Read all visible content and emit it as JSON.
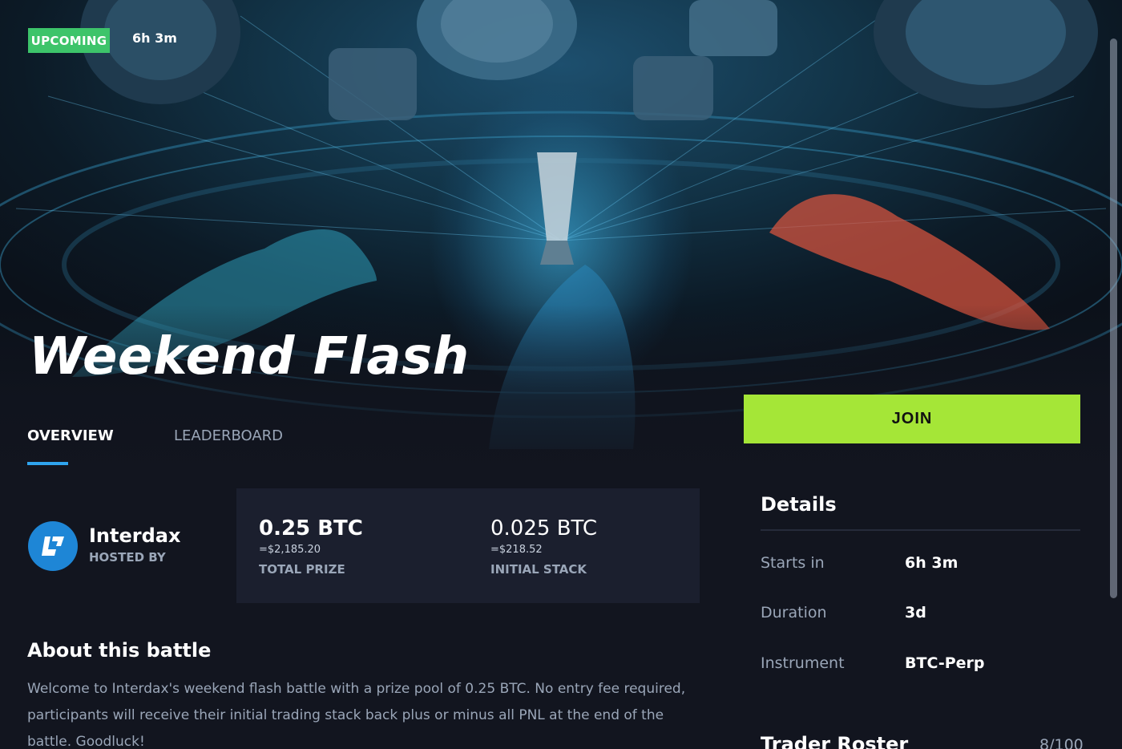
{
  "header": {
    "status_badge": "UPCOMING",
    "countdown": "6h 3m",
    "title": "Weekend Flash"
  },
  "tabs": [
    {
      "label": "OVERVIEW",
      "active": true
    },
    {
      "label": "LEADERBOARD",
      "active": false
    }
  ],
  "join_button": {
    "label": "JOIN"
  },
  "host": {
    "name": "Interdax",
    "caption": "HOSTED BY",
    "logo_icon": "interdax-logo-icon"
  },
  "prize": {
    "total": {
      "value": "0.25 BTC",
      "usd": "=$2,185.20",
      "label": "TOTAL PRIZE"
    },
    "stack": {
      "value": "0.025 BTC",
      "usd": "=$218.52",
      "label": "INITIAL STACK"
    }
  },
  "about": {
    "heading": "About this battle",
    "text": "Welcome to Interdax's weekend flash battle with a prize pool of 0.25 BTC. No entry fee required, participants will receive their initial trading stack back plus or minus all PNL at the end of the battle. Goodluck!"
  },
  "details": {
    "heading": "Details",
    "rows": [
      {
        "label": "Starts in",
        "value": "6h 3m"
      },
      {
        "label": "Duration",
        "value": "3d"
      },
      {
        "label": "Instrument",
        "value": "BTC-Perp"
      }
    ]
  },
  "roster": {
    "heading": "Trader Roster",
    "count": "8/100"
  },
  "colors": {
    "background": "#12151f",
    "card": "#1b1f2e",
    "accent_green": "#a5e637",
    "badge_green": "#3dc46a",
    "tab_underline": "#2fa4ee",
    "muted_text": "#9aa6b8"
  }
}
